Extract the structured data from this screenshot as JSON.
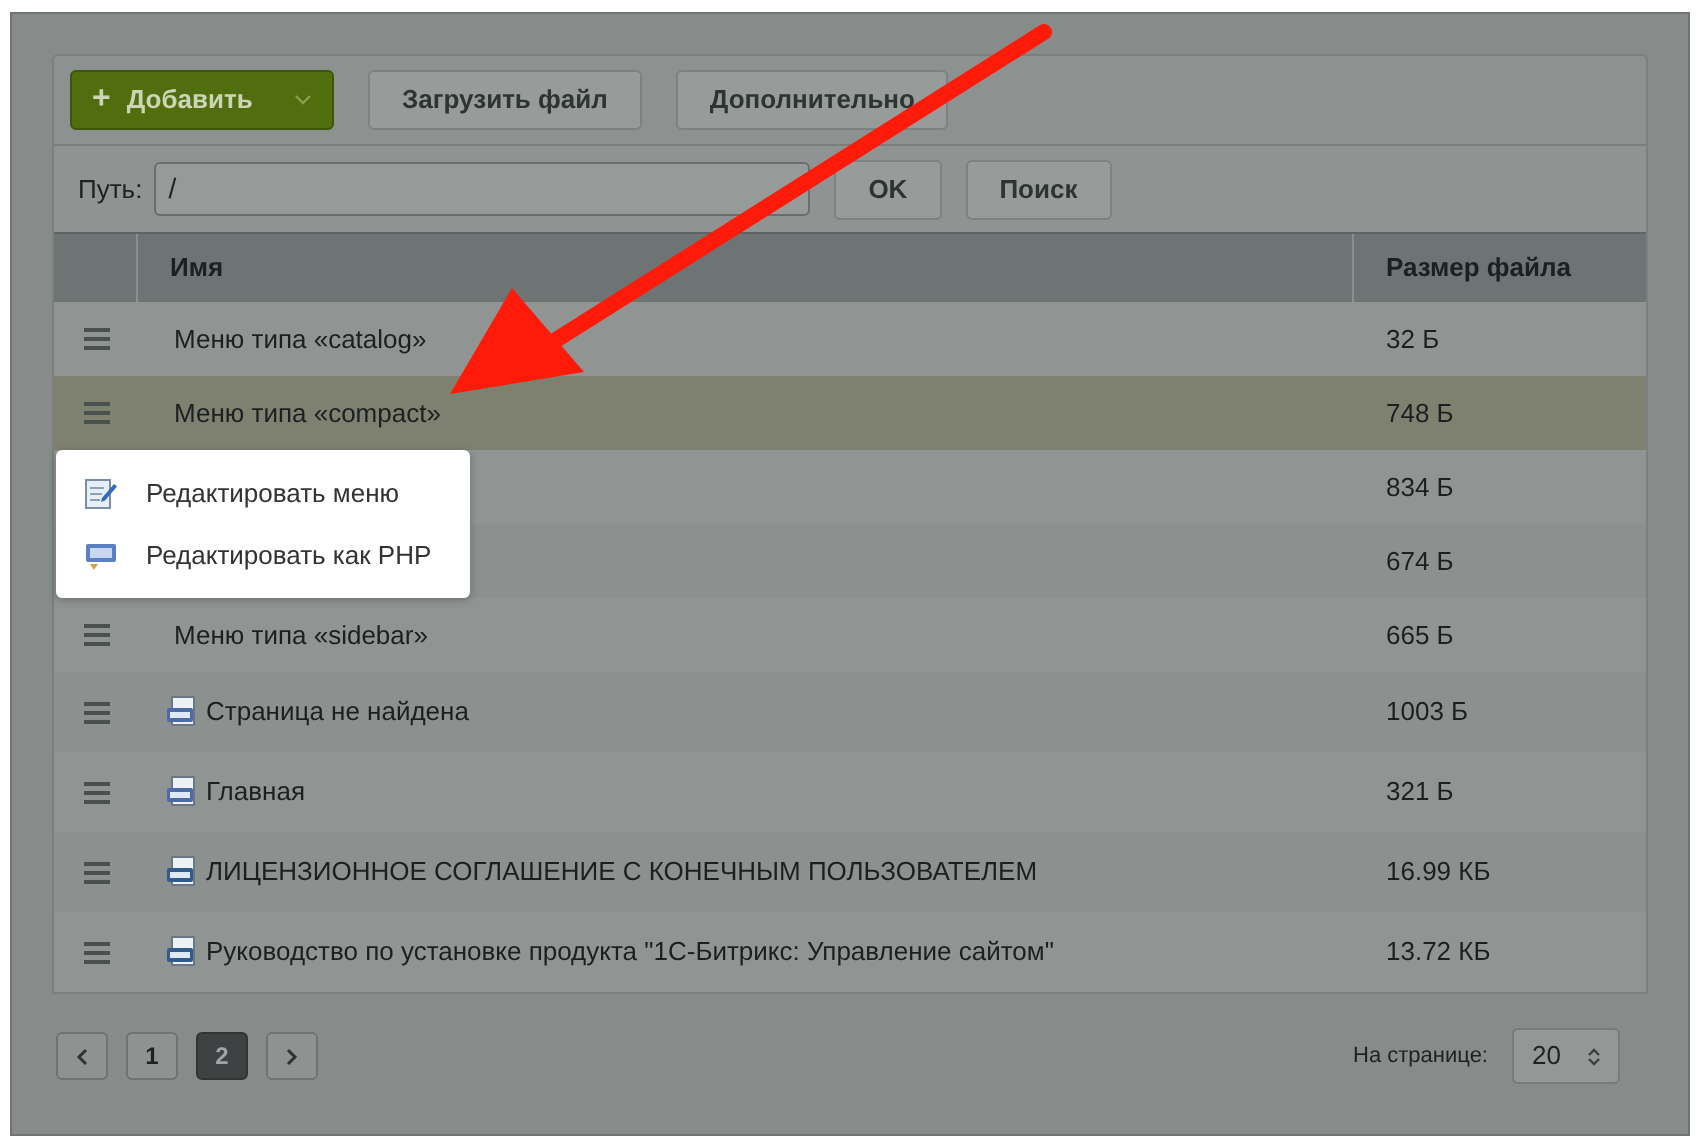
{
  "toolbar": {
    "add_button": "Добавить",
    "add_icon": "+",
    "buttons": [
      "Загрузить файл",
      "Дополнительно"
    ]
  },
  "path": {
    "label": "Путь:",
    "value": "/",
    "buttons": [
      "OK",
      "Поиск"
    ]
  },
  "table": {
    "columns": [
      "Имя",
      "Размер файла"
    ],
    "rows": [
      {
        "kind": "menu",
        "name": "Меню типа «catalog»",
        "size": "32 Б",
        "selected": false
      },
      {
        "kind": "menu",
        "name": "Меню типа «compact»",
        "size": "748 Б",
        "selected": true
      },
      {
        "kind": "menu",
        "size": "834 Б",
        "selected": false
      },
      {
        "kind": "menu",
        "size": "674 Б",
        "selected": false
      },
      {
        "kind": "menu",
        "name": "Меню типа «sidebar»",
        "size": "665 Б",
        "selected": false
      },
      {
        "kind": "php",
        "name": "Страница не найдена",
        "size": "1003 Б",
        "selected": false
      },
      {
        "kind": "php",
        "name": "Главная",
        "size": "321 Б",
        "selected": false
      },
      {
        "kind": "htm",
        "name": "ЛИЦЕНЗИОННОЕ СОГЛАШЕНИЕ С КОНЕЧНЫМ ПОЛЬЗОВАТЕЛЕМ",
        "size": "16.99 КБ",
        "selected": false
      },
      {
        "kind": "htm",
        "name": "Руководство по установке продукта \"1С-Битрикс: Управление сайтом\"",
        "size": "13.72 КБ",
        "selected": false
      }
    ]
  },
  "context_menu": [
    {
      "kind": "edit",
      "label": "Редактировать меню"
    },
    {
      "kind": "php",
      "label": "Редактировать как PHP"
    }
  ],
  "pagination": {
    "pages": [
      {
        "label": "1",
        "selected": false
      },
      {
        "label": "2",
        "selected": true
      }
    ],
    "per_page_label": "На странице:",
    "per_page": "20"
  }
}
